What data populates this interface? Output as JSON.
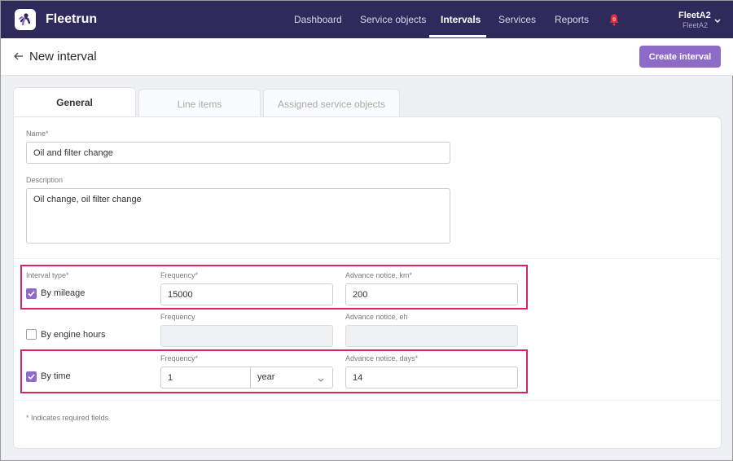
{
  "app": {
    "brand": "Fleetrun"
  },
  "nav": {
    "items": [
      {
        "label": "Dashboard"
      },
      {
        "label": "Service objects"
      },
      {
        "label": "Intervals"
      },
      {
        "label": "Services"
      },
      {
        "label": "Reports"
      }
    ],
    "active": "Intervals",
    "notification_count": "9"
  },
  "user": {
    "name": "FleetA2",
    "account": "FleetA2"
  },
  "header": {
    "title": "New interval",
    "primary_button": "Create interval"
  },
  "tabs": [
    {
      "label": "General"
    },
    {
      "label": "Line items"
    },
    {
      "label": "Assigned service objects"
    }
  ],
  "form": {
    "required_mark": "*",
    "name": {
      "label": "Name",
      "value": "Oil and filter change"
    },
    "description": {
      "label": "Description",
      "value": "Oil change, oil filter change"
    },
    "interval_type_label": "Interval type",
    "rows": {
      "mileage": {
        "label": "By mileage",
        "checked": true,
        "frequency_label": "Frequency",
        "frequency": "15000",
        "notice_label": "Advance notice, km",
        "notice": "200"
      },
      "engine_hours": {
        "label": "By engine hours",
        "checked": false,
        "frequency_label": "Frequency",
        "frequency": "",
        "notice_label": "Advance notice, eh",
        "notice": ""
      },
      "time": {
        "label": "By time",
        "checked": true,
        "frequency_label": "Frequency",
        "frequency": "1",
        "unit": "year",
        "notice_label": "Advance notice, days",
        "notice": "14"
      }
    },
    "footnote": "Indicates required fields"
  },
  "colors": {
    "topbar": "#2e2a5c",
    "accent": "#8e6bc9",
    "highlight": "#d9265a"
  }
}
